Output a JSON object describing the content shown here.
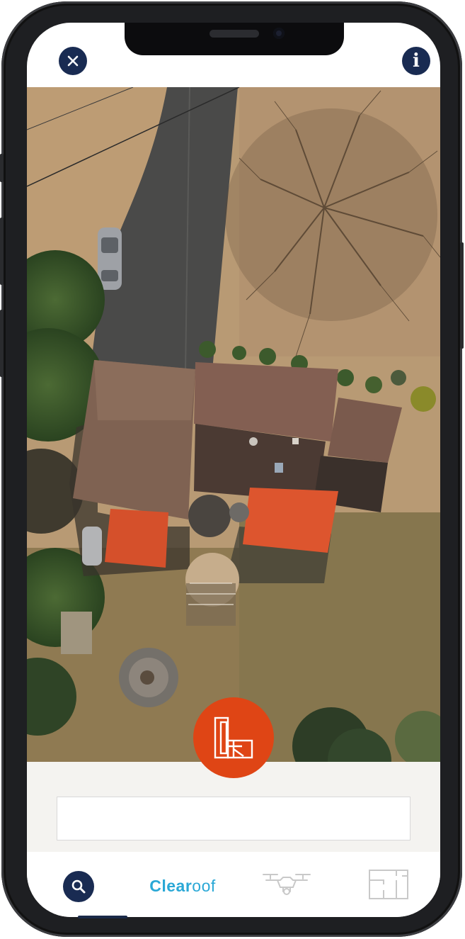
{
  "app": {
    "brand_bold": "Clear",
    "brand_light": "oof"
  },
  "top_bar": {
    "close_icon": "close-icon",
    "info_icon": "info-icon",
    "info_glyph": "i"
  },
  "map": {
    "view": "aerial-satellite",
    "marker_icon": "clearoof-logo-icon"
  },
  "address_search": {
    "value": "",
    "placeholder": ""
  },
  "bottom_nav": {
    "items": [
      {
        "name": "search",
        "icon": "search-icon",
        "active": true
      },
      {
        "name": "brand",
        "icon": "clearoof-wordmark"
      },
      {
        "name": "drone",
        "icon": "drone-icon",
        "active": false
      },
      {
        "name": "floorplan",
        "icon": "floorplan-icon",
        "active": false
      }
    ]
  },
  "colors": {
    "navy": "#192b52",
    "brand_orange": "#df4515",
    "brand_blue": "#2aa8d6",
    "inactive_icon": "#c9c9c9"
  }
}
